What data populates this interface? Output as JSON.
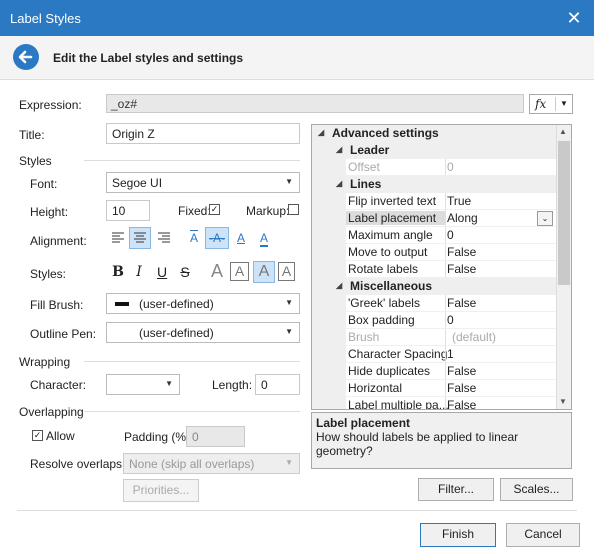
{
  "window": {
    "title": "Label Styles",
    "close_glyph": "✕"
  },
  "header": {
    "text": "Edit the Label styles and settings"
  },
  "expression": {
    "label": "Expression:",
    "value": "_oz#",
    "fx": "fx"
  },
  "title_field": {
    "label": "Title:",
    "value": "Origin Z"
  },
  "styles": {
    "section": "Styles",
    "font_label": "Font:",
    "font_value": "Segoe UI",
    "height_label": "Height:",
    "height_value": "10",
    "fixed_label": "Fixed:",
    "markup_label": "Markup:",
    "alignment_label": "Alignment:",
    "styles_label": "Styles:",
    "fill_label": "Fill Brush:",
    "fill_value": "(user-defined)",
    "outline_label": "Outline Pen:",
    "outline_value": "(user-defined)"
  },
  "wrapping": {
    "section": "Wrapping",
    "character_label": "Character:",
    "length_label": "Length:",
    "length_value": "0"
  },
  "overlapping": {
    "section": "Overlapping",
    "allow_label": "Allow",
    "padding_label": "Padding (%):",
    "padding_value": "0",
    "resolve_label": "Resolve overlaps:",
    "resolve_value": "None (skip all overlaps)",
    "priorities_button": "Priorities..."
  },
  "advanced": {
    "title": "Advanced settings",
    "rows": [
      {
        "type": "sub",
        "name": "Leader"
      },
      {
        "type": "prop",
        "name": "Offset",
        "value": "0",
        "disabled": true
      },
      {
        "type": "sub",
        "name": "Lines"
      },
      {
        "type": "prop",
        "name": "Flip inverted text",
        "value": "True"
      },
      {
        "type": "prop",
        "name": "Label placement",
        "value": "Along",
        "selected": true
      },
      {
        "type": "prop",
        "name": "Maximum angle",
        "value": "0"
      },
      {
        "type": "prop",
        "name": "Move to output",
        "value": "False"
      },
      {
        "type": "prop",
        "name": "Rotate labels",
        "value": "False"
      },
      {
        "type": "sub",
        "name": "Miscellaneous"
      },
      {
        "type": "prop",
        "name": "'Greek' labels",
        "value": "False"
      },
      {
        "type": "prop",
        "name": "Box padding",
        "value": "0"
      },
      {
        "type": "prop",
        "name": "Brush",
        "value": "(default)",
        "disabled": true
      },
      {
        "type": "prop",
        "name": "Character Spacing",
        "value": "1"
      },
      {
        "type": "prop",
        "name": "Hide duplicates",
        "value": "False"
      },
      {
        "type": "prop",
        "name": "Horizontal",
        "value": "False"
      },
      {
        "type": "prop",
        "name": "Label multiple pa...",
        "value": "False"
      }
    ],
    "desc_title": "Label placement",
    "desc_text": "How should labels be applied to linear geometry?"
  },
  "buttons": {
    "filter": "Filter...",
    "scales": "Scales...",
    "finish": "Finish",
    "cancel": "Cancel"
  }
}
